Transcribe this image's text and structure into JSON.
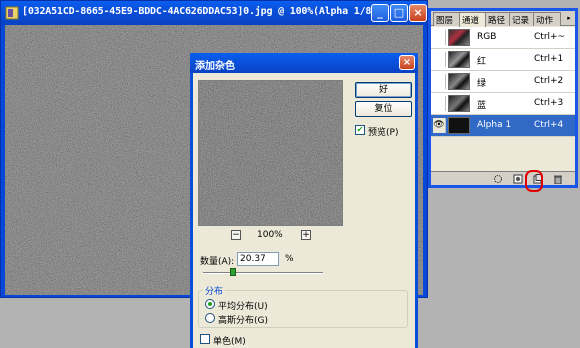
{
  "document": {
    "title": "[032A51CD-8665-45E9-BDDC-4AC626DDAC53]0.jpg @ 100%(Alpha 1/8)",
    "minimize": "_",
    "maximize": "□",
    "close": "×"
  },
  "palette": {
    "tabs": [
      "图层",
      "通道",
      "路径",
      "记录",
      "动作"
    ],
    "menu_arrow": "▸",
    "channels": [
      {
        "name": "RGB",
        "shortcut": "Ctrl+~",
        "visible": ""
      },
      {
        "name": "红",
        "shortcut": "Ctrl+1",
        "visible": ""
      },
      {
        "name": "绿",
        "shortcut": "Ctrl+2",
        "visible": ""
      },
      {
        "name": "蓝",
        "shortcut": "Ctrl+3",
        "visible": ""
      },
      {
        "name": "Alpha 1",
        "shortcut": "Ctrl+4",
        "visible": "👁"
      }
    ],
    "buttons": [
      "load-selection",
      "save-selection",
      "new-channel",
      "delete-channel"
    ]
  },
  "dialog": {
    "title": "添加杂色",
    "close": "×",
    "ok_label": "好",
    "reset_label": "复位",
    "preview_label": "预览(P)",
    "preview_checked": "✔",
    "zoom_minus": "−",
    "zoom_plus": "+",
    "zoom_level": "100%",
    "amount_label": "数量(A):",
    "amount_value": "20.37",
    "amount_unit": "%",
    "amount_slider_fraction": 0.2037,
    "distribution_label": "分布",
    "uniform_label": "平均分布(U)",
    "gaussian_label": "高斯分布(G)",
    "monochrome_label": "单色(M)",
    "selected_distribution": "uniform"
  }
}
